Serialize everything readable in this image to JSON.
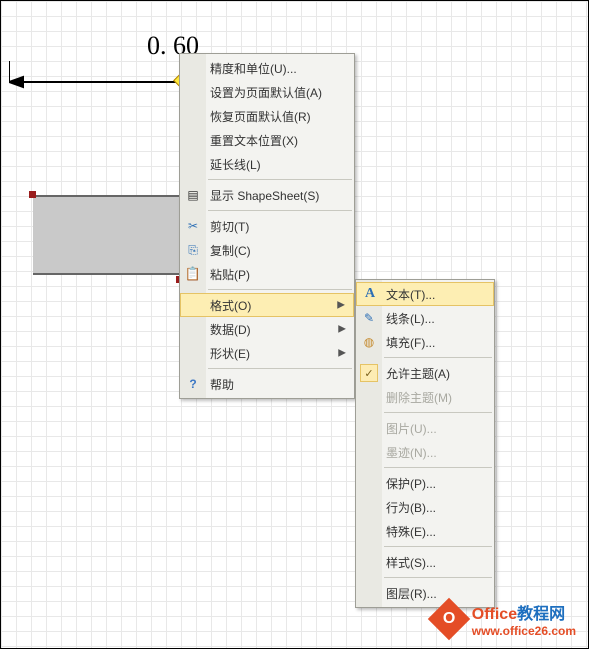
{
  "canvas": {
    "dimension_label": "0. 60"
  },
  "menu1": {
    "items": [
      {
        "label": "精度和单位(U)...",
        "icon": ""
      },
      {
        "label": "设置为页面默认值(A)",
        "icon": ""
      },
      {
        "label": "恢复页面默认值(R)",
        "icon": ""
      },
      {
        "label": "重置文本位置(X)",
        "icon": ""
      },
      {
        "label": "延长线(L)",
        "icon": ""
      }
    ],
    "items2": [
      {
        "label": "显示 ShapeSheet(S)",
        "icon": "sheet"
      }
    ],
    "items3": [
      {
        "label": "剪切(T)",
        "icon": "cut"
      },
      {
        "label": "复制(C)",
        "icon": "copy"
      },
      {
        "label": "粘贴(P)",
        "icon": "paste"
      }
    ],
    "items4": [
      {
        "label": "格式(O)",
        "icon": "",
        "sub": true,
        "hover": true
      },
      {
        "label": "数据(D)",
        "icon": "",
        "sub": true
      },
      {
        "label": "形状(E)",
        "icon": "",
        "sub": true
      }
    ],
    "items5": [
      {
        "label": "帮助",
        "icon": "help"
      }
    ]
  },
  "menu2": {
    "items": [
      {
        "label": "文本(T)...",
        "icon": "text",
        "hover": true
      },
      {
        "label": "线条(L)...",
        "icon": "line"
      },
      {
        "label": "填充(F)...",
        "icon": "fill"
      }
    ],
    "items2": [
      {
        "label": "允许主题(A)",
        "icon": "check"
      },
      {
        "label": "删除主题(M)",
        "icon": "",
        "disabled": true
      }
    ],
    "items3": [
      {
        "label": "图片(U)...",
        "icon": "",
        "disabled": true
      },
      {
        "label": "墨迹(N)...",
        "icon": "",
        "disabled": true
      }
    ],
    "items4": [
      {
        "label": "保护(P)...",
        "icon": ""
      },
      {
        "label": "行为(B)...",
        "icon": ""
      },
      {
        "label": "特殊(E)...",
        "icon": ""
      }
    ],
    "items5": [
      {
        "label": "样式(S)...",
        "icon": ""
      }
    ],
    "items6": [
      {
        "label": "图层(R)...",
        "icon": ""
      }
    ]
  },
  "watermark": {
    "brand_prefix": "Office",
    "brand_suffix": "教程网",
    "url": "www.office26.com",
    "logo_letter": "O"
  },
  "icons": {
    "sheet": "▤",
    "cut": "✂",
    "copy": "⎘",
    "paste": "📋",
    "help": "?",
    "text": "A",
    "line": "✎",
    "fill": "◍",
    "check": "✓"
  }
}
